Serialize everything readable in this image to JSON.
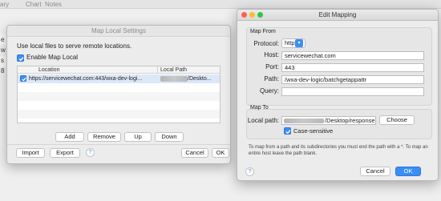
{
  "background": {
    "menu": [
      "ary",
      "Chart",
      "Notes"
    ],
    "fragments": [
      "e",
      "w",
      "s",
      "8"
    ]
  },
  "map_local": {
    "title": "Map Local Settings",
    "description": "Use local files to serve remote locations.",
    "enable_label": "Enable Map Local",
    "enabled": true,
    "columns": [
      "Location",
      "Local Path"
    ],
    "rows": [
      {
        "checked": true,
        "location": "https://servicewechat.com:443/wxa-dev-logi...",
        "local_path": "/Deskto..."
      }
    ],
    "buttons": {
      "add": "Add",
      "remove": "Remove",
      "up": "Up",
      "down": "Down",
      "import": "Import",
      "export": "Export",
      "help": "?",
      "cancel": "Cancel",
      "ok": "OK"
    }
  },
  "edit_mapping": {
    "title": "Edit Mapping",
    "map_from_label": "Map From",
    "protocol_label": "Protocol:",
    "protocol_value": "https",
    "host_label": "Host:",
    "host_value": "servicewechat.com",
    "port_label": "Port:",
    "port_value": "443",
    "path_label": "Path:",
    "path_value": "/wxa-dev-logic/batchgetappattr",
    "query_label": "Query:",
    "query_value": "",
    "map_to_label": "Map To",
    "local_path_label": "Local path:",
    "local_path_value": "/Desktop/response",
    "choose_label": "Choose",
    "case_sensitive_label": "Case-sensitive",
    "case_sensitive": true,
    "note": "To map from a path and its subdirectories you must end the path with a *. To map an entire host leave the path blank.",
    "help": "?",
    "cancel": "Cancel",
    "ok": "OK"
  },
  "colors": {
    "accent": "#3a8ef6",
    "traffic_red": "#fc5f57",
    "traffic_yellow": "#fdbc2e",
    "traffic_green": "#2ac840"
  }
}
